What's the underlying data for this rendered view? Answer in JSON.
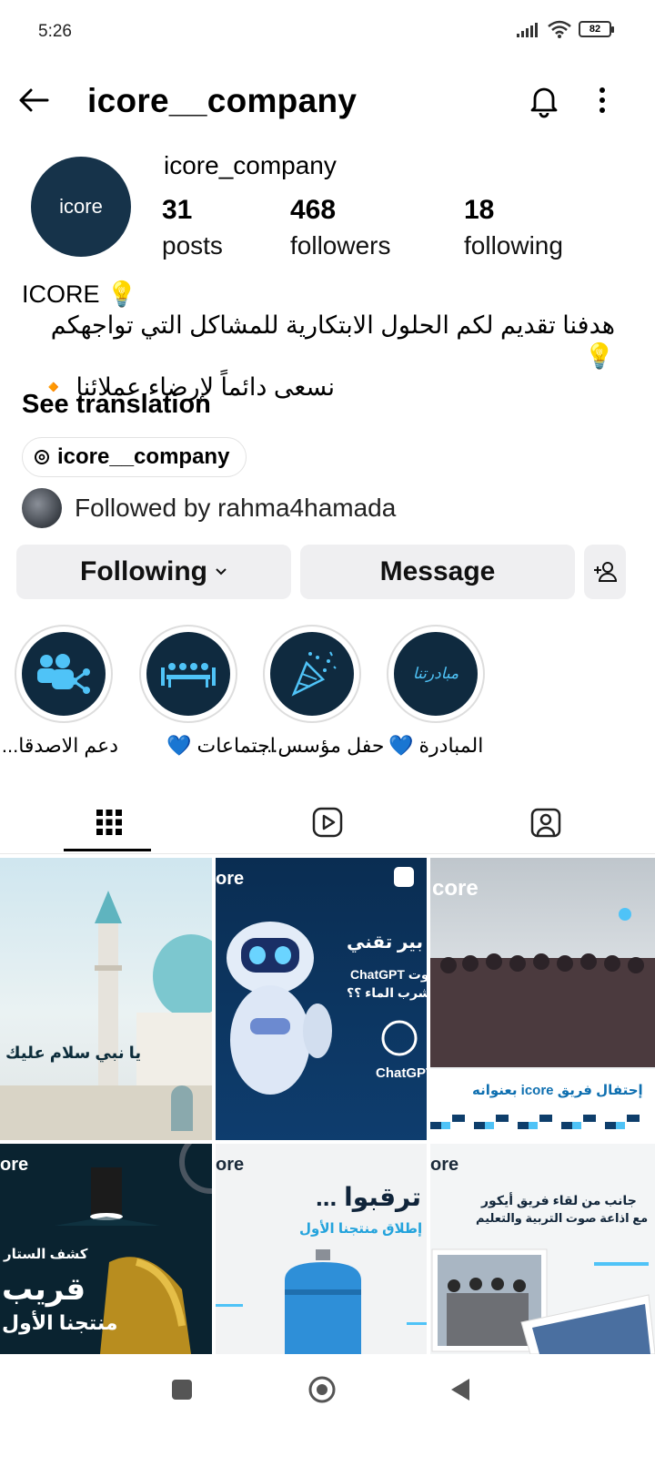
{
  "status_bar": {
    "time": "5:26",
    "battery": "82"
  },
  "header": {
    "title": "icore__company"
  },
  "profile": {
    "avatar_text": "icore",
    "name": "icore_company",
    "stats": [
      {
        "value": "31",
        "label": "posts"
      },
      {
        "value": "468",
        "label": "followers"
      },
      {
        "value": "18",
        "label": "following"
      }
    ],
    "bio_title": "ICORE 💡",
    "bio_line1": "هدفنا تقديم لكم الحلول الابتكارية للمشاكل التي تواجهكم💡",
    "bio_line2": "نسعى دائماً لإرضاء عملائنا 🔸",
    "see_translation": "See translation",
    "threads_handle": "icore__company",
    "followed_by": "Followed by rahma4hamada"
  },
  "actions": {
    "following": "Following",
    "message": "Message"
  },
  "highlights": [
    {
      "label": "المبادرة 💙",
      "icon": "initiative-logo",
      "logo_text": "مبادرتنا"
    },
    {
      "label": "حفل مؤسس...",
      "icon": "celebration-icon"
    },
    {
      "label": "اجتماعات 💙",
      "icon": "meeting-icon"
    },
    {
      "label": "دعم الاصدقا...",
      "icon": "share-people-icon"
    }
  ],
  "tabs": [
    {
      "name": "grid",
      "icon": "grid-icon",
      "active": true
    },
    {
      "name": "reels",
      "icon": "reels-icon",
      "active": false
    },
    {
      "name": "tagged",
      "icon": "tagged-icon",
      "active": false
    }
  ],
  "posts": [
    {
      "id": "post-1",
      "caption": "يا نبي سلام عليك"
    },
    {
      "id": "post-2",
      "caption": "ChatGPT",
      "title": "ChatGPT وت",
      "subtitle": "شرب الماء ؟؟",
      "brand": "ore"
    },
    {
      "id": "post-3",
      "brand": "core",
      "caption": "إحتفال فريق icore بعنوانه"
    },
    {
      "id": "post-4",
      "brand": "ore",
      "title": "قريب",
      "subtitle": "كشف الستار",
      "caption": "منتجنا الأول"
    },
    {
      "id": "post-5",
      "brand": "ore",
      "title": "ترقبوا ...",
      "subtitle": "إطلاق منتجنا الأول"
    },
    {
      "id": "post-6",
      "brand": "ore",
      "title": "جانب من لقاء فريق أيكور",
      "subtitle": "مع اذاعة صوت التربية والتعليم"
    }
  ],
  "colors": {
    "brand_navy": "#16334a",
    "accent_cyan": "#4fc3f7",
    "button_bg": "#efeff1"
  }
}
